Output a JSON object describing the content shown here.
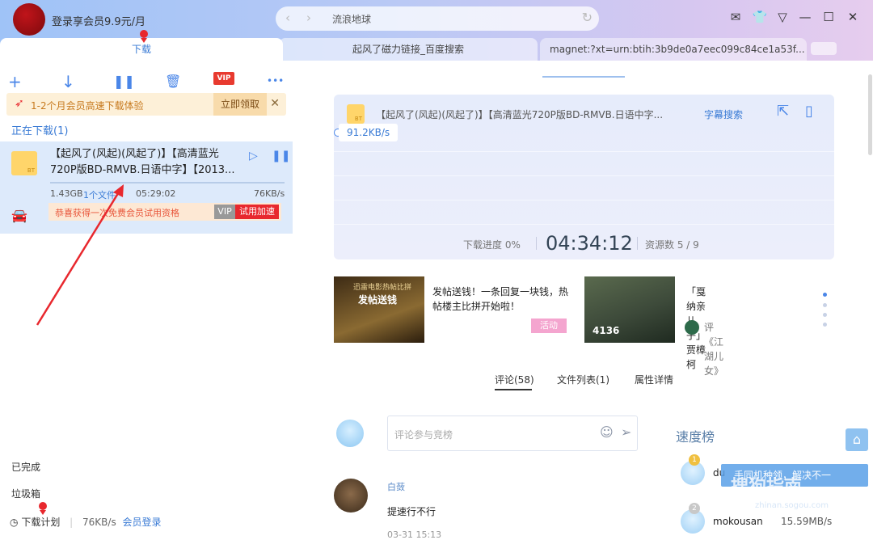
{
  "titlebar": {
    "vip_promo": "登录享会员9.9元/月",
    "address": "流浪地球",
    "back": "‹",
    "forward": "›",
    "refresh": "↻"
  },
  "tabs": [
    {
      "label": "下载"
    },
    {
      "label": "起风了磁力链接_百度搜索"
    },
    {
      "label": "magnet:?xt=urn:btih:3b9de0a7eec099c84ce1a53f..."
    }
  ],
  "toolbar": {
    "add": "+",
    "download": "↓",
    "pause": "❚❚",
    "delete": "🗑",
    "vip": "VIP",
    "more": "•••"
  },
  "promo": {
    "text": "1-2个月会员高速下载体验",
    "button": "立即领取",
    "close": "✕"
  },
  "downloading": {
    "section": "正在下载(1)",
    "file_badge": "BT",
    "name": "【起风了(风起)(风起了)】【高清蓝光720P版BD-RMVB.日语中字】【2013...",
    "size": "1.43GB",
    "files": "1个文件",
    "eta": "05:29:02",
    "speed": "76KB/s",
    "trial_text": "恭喜获得一次免费会员试用资格",
    "trial_vip": "VIP",
    "trial_button": "试用加速"
  },
  "left_nav": {
    "done": "已完成",
    "trash": "垃圾箱"
  },
  "status": {
    "plan": "下载计划",
    "speed": "76KB/s",
    "login": "会员登录"
  },
  "detail": {
    "file_badge": "BT",
    "title": "【起风了(风起)(风起了)】【高清蓝光720P版BD-RMVB.日语中字...",
    "subtitle_search": "字幕搜索",
    "speed": "91.2KB/s",
    "progress_label": "下载进度 0%",
    "time": "04:34:12",
    "resources": "资源数 5 / 9"
  },
  "promos": [
    {
      "thumb_line1": "迅雷电影热帖比拼",
      "thumb_line2": "发帖送钱",
      "text": "发帖送钱！一条回复一块钱，热帖楼主比拼开始啦！",
      "tag": "活动"
    },
    {
      "views": "4136",
      "text": "「戛纳亲儿子」贾樟柯",
      "review": "评《江湖儿女》"
    }
  ],
  "comment_tabs": {
    "comments": "评论(58)",
    "files": "文件列表(1)",
    "props": "属性详情"
  },
  "comment_box": {
    "placeholder": "评论参与竞榜",
    "emoji": "☺",
    "send": "➢"
  },
  "comment": {
    "user": "白蔹",
    "text": "提速行不行",
    "date": "03-31 15:13"
  },
  "ranking": {
    "title": "速度榜",
    "rows": [
      {
        "rank": "1",
        "name": "du",
        "speed": ""
      },
      {
        "rank": "2",
        "name": "mokousan",
        "speed": "15.59MB/s"
      }
    ]
  },
  "overlay": {
    "banner": "手同机种领，解决不一",
    "watermark": "搜狗指南",
    "url": "zhinan.sogou.com"
  },
  "colors": {
    "accent": "#3a7bd5",
    "annotation": "#e8282e"
  }
}
